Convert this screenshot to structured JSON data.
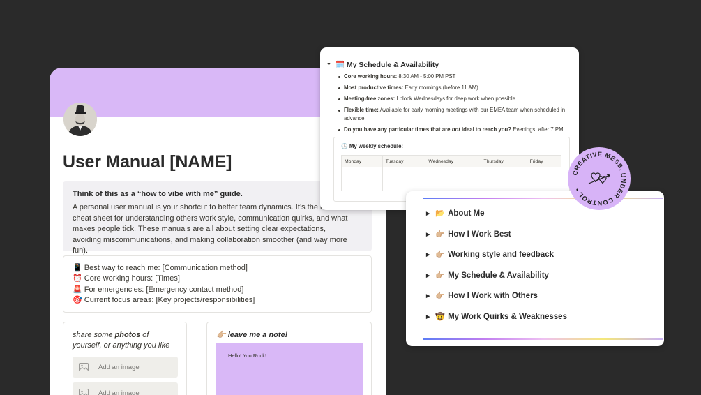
{
  "manual": {
    "title": "User Manual [NAME]",
    "callout_title": "Think of this as a “how to vibe with me” guide.",
    "callout_body": "A personal user manual is your shortcut to better team dynamics. It’s the ultimate cheat sheet for understanding others work style, communication quirks, and what makes people tick. These manuals are all about setting clear expectations, avoiding miscommunications, and making collaboration smoother (and way more fun).",
    "facts": [
      "📱 Best way to reach me: [Communication method]",
      "⏰ Core working hours: [Times]",
      "🚨 For emergencies: [Emergency contact method]",
      "🎯 Current focus areas: [Key projects/responsibilities]"
    ],
    "photos_prefix": "share some ",
    "photos_bold": "photos",
    "photos_suffix": " of yourself, or anything you like",
    "add_image": "Add an image",
    "add_image_2": "Add an image",
    "note_label": "👉🏼 leave me a note!",
    "note_text": "Hello! You Rock!"
  },
  "schedule": {
    "title": "🗓️ My Schedule & Availability",
    "items": [
      {
        "label": "Core working hours:",
        "text": " 8:30 AM - 5:00 PM PST"
      },
      {
        "label": "Most productive times:",
        "text": " Early mornings (before 11 AM)"
      },
      {
        "label": "Meeting-free zones:",
        "text": " I block Wednesdays for deep work when possible"
      },
      {
        "label": "Flexible time:",
        "text": " Available for early morning meetings with our EMEA team when scheduled in advance"
      }
    ],
    "q_prefix": "Do you have any particular times that are ",
    "q_em": "not",
    "q_suffix": " ideal to reach you?",
    "q_answer": " Evenings, after 7 PM.",
    "weekly_title": "🕒 My weekly schedule:",
    "days": [
      "Monday",
      "Tuesday",
      "Wednesday",
      "Thursday",
      "Friday"
    ]
  },
  "toc": {
    "items": [
      {
        "emoji": "📂",
        "label": "About Me"
      },
      {
        "emoji": "👉🏼",
        "label": "How I Work Best"
      },
      {
        "emoji": "👉🏼",
        "label": "Working style and feedback"
      },
      {
        "emoji": "👉🏼",
        "label": "My Schedule & Availability"
      },
      {
        "emoji": "👉🏼",
        "label": "How I Work with Others"
      },
      {
        "emoji": "🤠",
        "label": "My Work Quirks & Weaknesses"
      }
    ]
  },
  "badge": {
    "text": "CREATIVE MESS, UNDER CONTROL •"
  },
  "colors": {
    "background": "#2a2a2a",
    "banner": "#d9b8f7",
    "badge": "#d7b3f7"
  }
}
